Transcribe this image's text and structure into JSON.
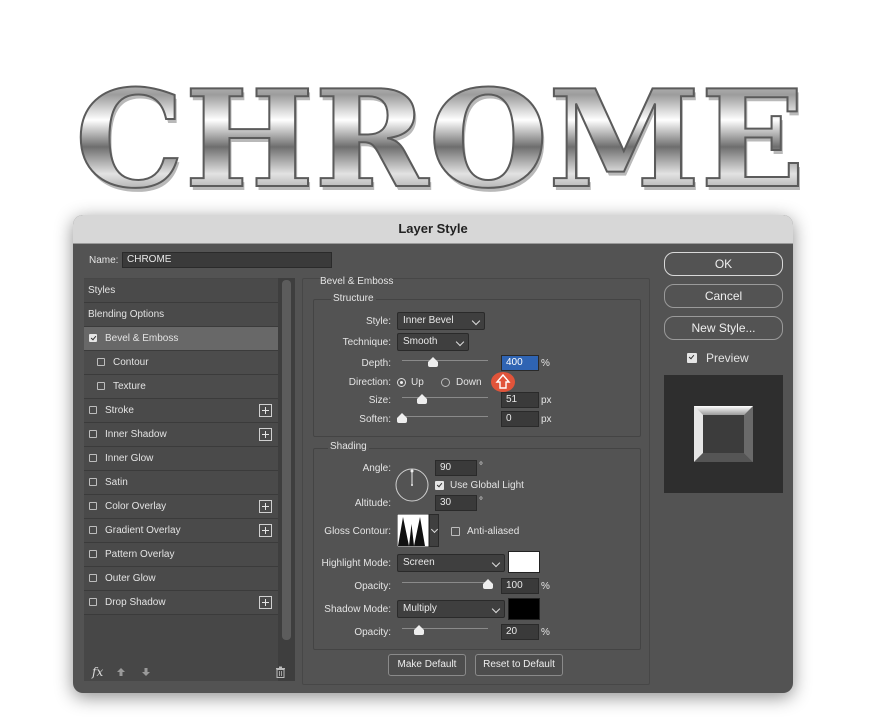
{
  "banner": {
    "text": "CHROME"
  },
  "dialog": {
    "title": "Layer Style",
    "name_label": "Name:",
    "name_value": "CHROME",
    "sidebar": {
      "header": "Styles",
      "items": [
        {
          "label": "Blending Options",
          "kind": "hdr"
        },
        {
          "label": "Bevel & Emboss",
          "checked": true,
          "selected": true
        },
        {
          "label": "Contour",
          "sub": true
        },
        {
          "label": "Texture",
          "sub": true
        },
        {
          "label": "Stroke",
          "plus": true
        },
        {
          "label": "Inner Shadow",
          "plus": true
        },
        {
          "label": "Inner Glow"
        },
        {
          "label": "Satin"
        },
        {
          "label": "Color Overlay",
          "plus": true
        },
        {
          "label": "Gradient Overlay",
          "plus": true
        },
        {
          "label": "Pattern Overlay"
        },
        {
          "label": "Outer Glow"
        },
        {
          "label": "Drop Shadow",
          "plus": true
        }
      ],
      "footer_icons": [
        "fx-icon",
        "arrow-up-icon",
        "arrow-down-icon",
        "trash-icon"
      ],
      "fx_label": "fx"
    },
    "bevel": {
      "section_title": "Bevel & Emboss",
      "structure_title": "Structure",
      "style_label": "Style:",
      "style_value": "Inner Bevel",
      "technique_label": "Technique:",
      "technique_value": "Smooth",
      "depth_label": "Depth:",
      "depth_value": "400",
      "depth_unit": "%",
      "depth_fraction": 0.36,
      "direction_label": "Direction:",
      "direction_up": "Up",
      "direction_down": "Down",
      "direction_selected": "Up",
      "size_label": "Size:",
      "size_value": "51",
      "size_unit": "px",
      "size_fraction": 0.23,
      "soften_label": "Soften:",
      "soften_value": "0",
      "soften_unit": "px",
      "soften_fraction": 0.0
    },
    "shading": {
      "title": "Shading",
      "angle_label": "Angle:",
      "angle_value": "90",
      "angle_unit": "°",
      "global_light_label": "Use Global Light",
      "global_light_checked": true,
      "altitude_label": "Altitude:",
      "altitude_value": "30",
      "altitude_unit": "°",
      "gloss_label": "Gloss Contour:",
      "anti_aliased_label": "Anti-aliased",
      "anti_aliased_checked": false,
      "highlight_mode_label": "Highlight Mode:",
      "highlight_mode_value": "Screen",
      "highlight_color": "#ffffff",
      "highlight_opacity_label": "Opacity:",
      "highlight_opacity_value": "100",
      "highlight_opacity_unit": "%",
      "highlight_opacity_fraction": 1.0,
      "shadow_mode_label": "Shadow Mode:",
      "shadow_mode_value": "Multiply",
      "shadow_color": "#000000",
      "shadow_opacity_label": "Opacity:",
      "shadow_opacity_value": "20",
      "shadow_opacity_unit": "%",
      "shadow_opacity_fraction": 0.2
    },
    "buttons": {
      "make_default": "Make Default",
      "reset_default": "Reset to Default",
      "ok": "OK",
      "cancel": "Cancel",
      "new_style": "New Style..."
    },
    "preview": {
      "label": "Preview",
      "checked": true
    },
    "colors": {
      "dialog_bg": "#535353",
      "field_highlight": "#2f64b3",
      "cursor_badge": "#e1543a"
    }
  }
}
